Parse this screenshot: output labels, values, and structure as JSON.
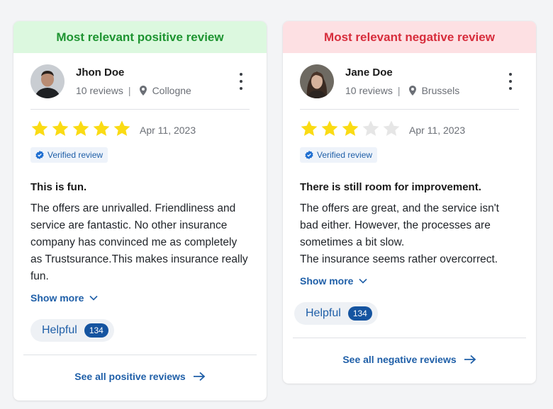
{
  "colors": {
    "positive_banner_bg": "#dcf8df",
    "positive_banner_text": "#1e9431",
    "negative_banner_bg": "#fde0e3",
    "negative_banner_text": "#d72d3c",
    "star_filled": "#fadb14",
    "star_empty": "#e6e6e6",
    "link_blue": "#1f5fa8"
  },
  "positive": {
    "banner": "Most relevant positive review",
    "reviewer_name": "Jhon Doe",
    "reviews_count": "10 reviews",
    "location": "Collogne",
    "rating": 5,
    "date": "Apr 11, 2023",
    "verified_label": "Verified review",
    "title": "This is fun.",
    "text": "The offers are unrivalled. Friendliness and service are fantastic. No other insurance company has convinced me as completely as Trustsurance.This makes insurance really fun.",
    "show_more": "Show more",
    "helpful_label": "Helpful",
    "helpful_count": "134",
    "see_all": "See all positive reviews"
  },
  "negative": {
    "banner": "Most relevant negative review",
    "reviewer_name": "Jane Doe",
    "reviews_count": "10 reviews",
    "location": "Brussels",
    "rating": 3,
    "date": "Apr 11, 2023",
    "verified_label": "Verified review",
    "title": "There is still room for improvement.",
    "text": "The offers are great, and the service isn't bad either. However, the processes are sometimes a bit slow.",
    "text2": "The insurance seems rather overcorrect.",
    "show_more": "Show more",
    "helpful_label": "Helpful",
    "helpful_count": "134",
    "see_all": "See all negative reviews"
  }
}
